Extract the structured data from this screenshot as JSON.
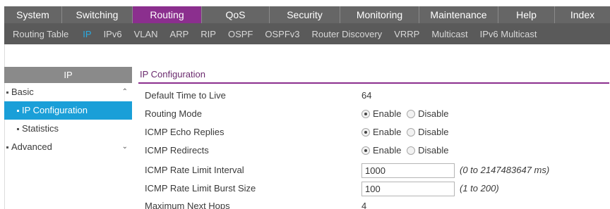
{
  "main_nav": [
    "System",
    "Switching",
    "Routing",
    "QoS",
    "Security",
    "Monitoring",
    "Maintenance",
    "Help",
    "Index"
  ],
  "main_nav_active": "Routing",
  "sub_nav": [
    "Routing Table",
    "IP",
    "IPv6",
    "VLAN",
    "ARP",
    "RIP",
    "OSPF",
    "OSPFv3",
    "Router Discovery",
    "VRRP",
    "Multicast",
    "IPv6 Multicast"
  ],
  "sub_nav_active": "IP",
  "sidebar": {
    "header": "IP",
    "basic": "Basic",
    "ip_configuration": "IP Configuration",
    "statistics": "Statistics",
    "advanced": "Advanced"
  },
  "section_title": "IP Configuration",
  "fields": {
    "ttl_label": "Default Time to Live",
    "ttl_value": "64",
    "routing_mode_label": "Routing Mode",
    "icmp_echo_label": "ICMP Echo Replies",
    "icmp_redirects_label": "ICMP Redirects",
    "rate_interval_label": "ICMP Rate Limit Interval",
    "rate_interval_value": "1000",
    "rate_interval_hint": "(0 to 2147483647 ms)",
    "burst_label": "ICMP Rate Limit Burst Size",
    "burst_value": "100",
    "burst_hint": "(1 to 200)",
    "max_hops_label": "Maximum Next Hops",
    "max_hops_value": "4"
  },
  "radio": {
    "enable": "Enable",
    "disable": "Disable"
  },
  "colors": {
    "accent": "#8b2f8e",
    "selected": "#1a9fd8",
    "nav_bg": "#666666",
    "subnav_bg": "#5a5a5a"
  }
}
